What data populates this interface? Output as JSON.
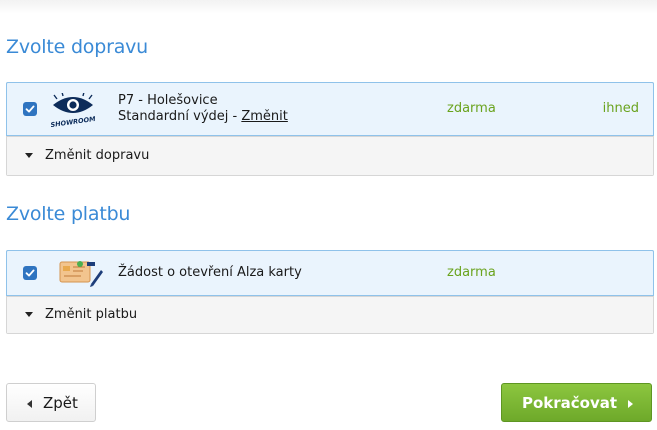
{
  "shipping": {
    "title": "Zvolte dopravu",
    "selected": {
      "checked": true,
      "logo": "showroom-eye-logo",
      "logo_text": "SHOWROOM",
      "line1": "P7 - Holešovice",
      "line2_prefix": "Standardní výdej - ",
      "change_link": "Změnit",
      "price": "zdarma",
      "availability": "ihned"
    },
    "toggle_label": "Změnit dopravu"
  },
  "payment": {
    "title": "Zvolte platbu",
    "selected": {
      "checked": true,
      "logo": "alza-card-application-icon",
      "label": "Žádost o otevření Alza karty",
      "price": "zdarma"
    },
    "toggle_label": "Změnit platbu"
  },
  "nav": {
    "back_label": "Zpět",
    "continue_label": "Pokračovat"
  },
  "colors": {
    "heading": "#3a8ad6",
    "selected_bg": "#eaf4fd",
    "price_green": "#6aa31e",
    "continue_green": "#7cb835",
    "checkbox_blue": "#2f74c0"
  }
}
